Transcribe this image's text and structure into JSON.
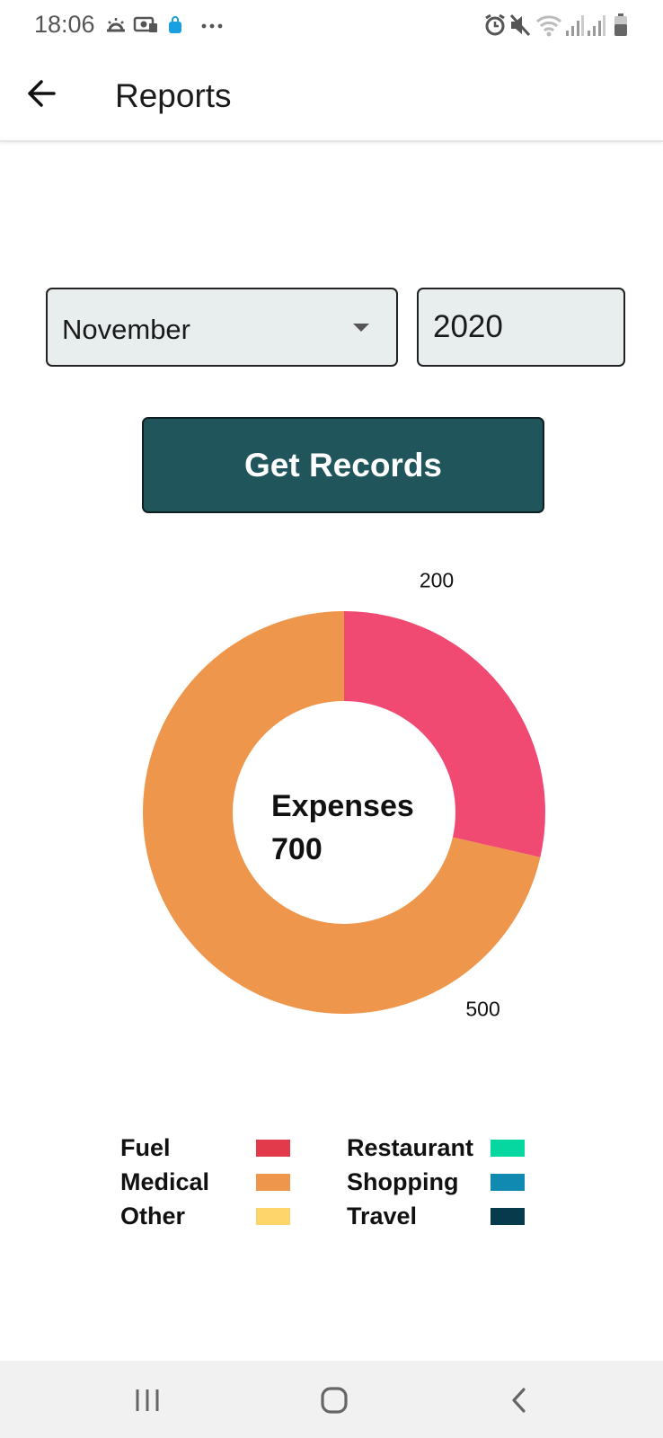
{
  "status_bar": {
    "time": "18:06",
    "left_icons": [
      "weather-icon",
      "money-icon",
      "shopping-bag-icon",
      "more-dots-icon"
    ],
    "right_icons": [
      "alarm-icon",
      "mute-icon",
      "wifi-icon",
      "signal-icon",
      "signal-icon",
      "battery-icon"
    ],
    "accent_blue": "#1aa0e0"
  },
  "app_bar": {
    "title": "Reports"
  },
  "filters": {
    "month": "November",
    "year": "2020"
  },
  "actions": {
    "get_records_label": "Get Records",
    "button_color": "#20555b"
  },
  "chart_data": {
    "type": "pie",
    "donut": true,
    "center_title": "Expenses",
    "center_value": "700",
    "slices": [
      {
        "name": "Fuel",
        "value": 200,
        "color": "#f04a73",
        "label": "200"
      },
      {
        "name": "Medical",
        "value": 500,
        "color": "#ee964b",
        "label": "500"
      }
    ],
    "legend": [
      {
        "name": "Fuel",
        "color": "#e23a4a"
      },
      {
        "name": "Medical",
        "color": "#ee964b"
      },
      {
        "name": "Other",
        "color": "#fdd56b"
      },
      {
        "name": "Restaurant",
        "color": "#06d6a0"
      },
      {
        "name": "Shopping",
        "color": "#118ab2"
      },
      {
        "name": "Travel",
        "color": "#073b4c"
      }
    ]
  }
}
